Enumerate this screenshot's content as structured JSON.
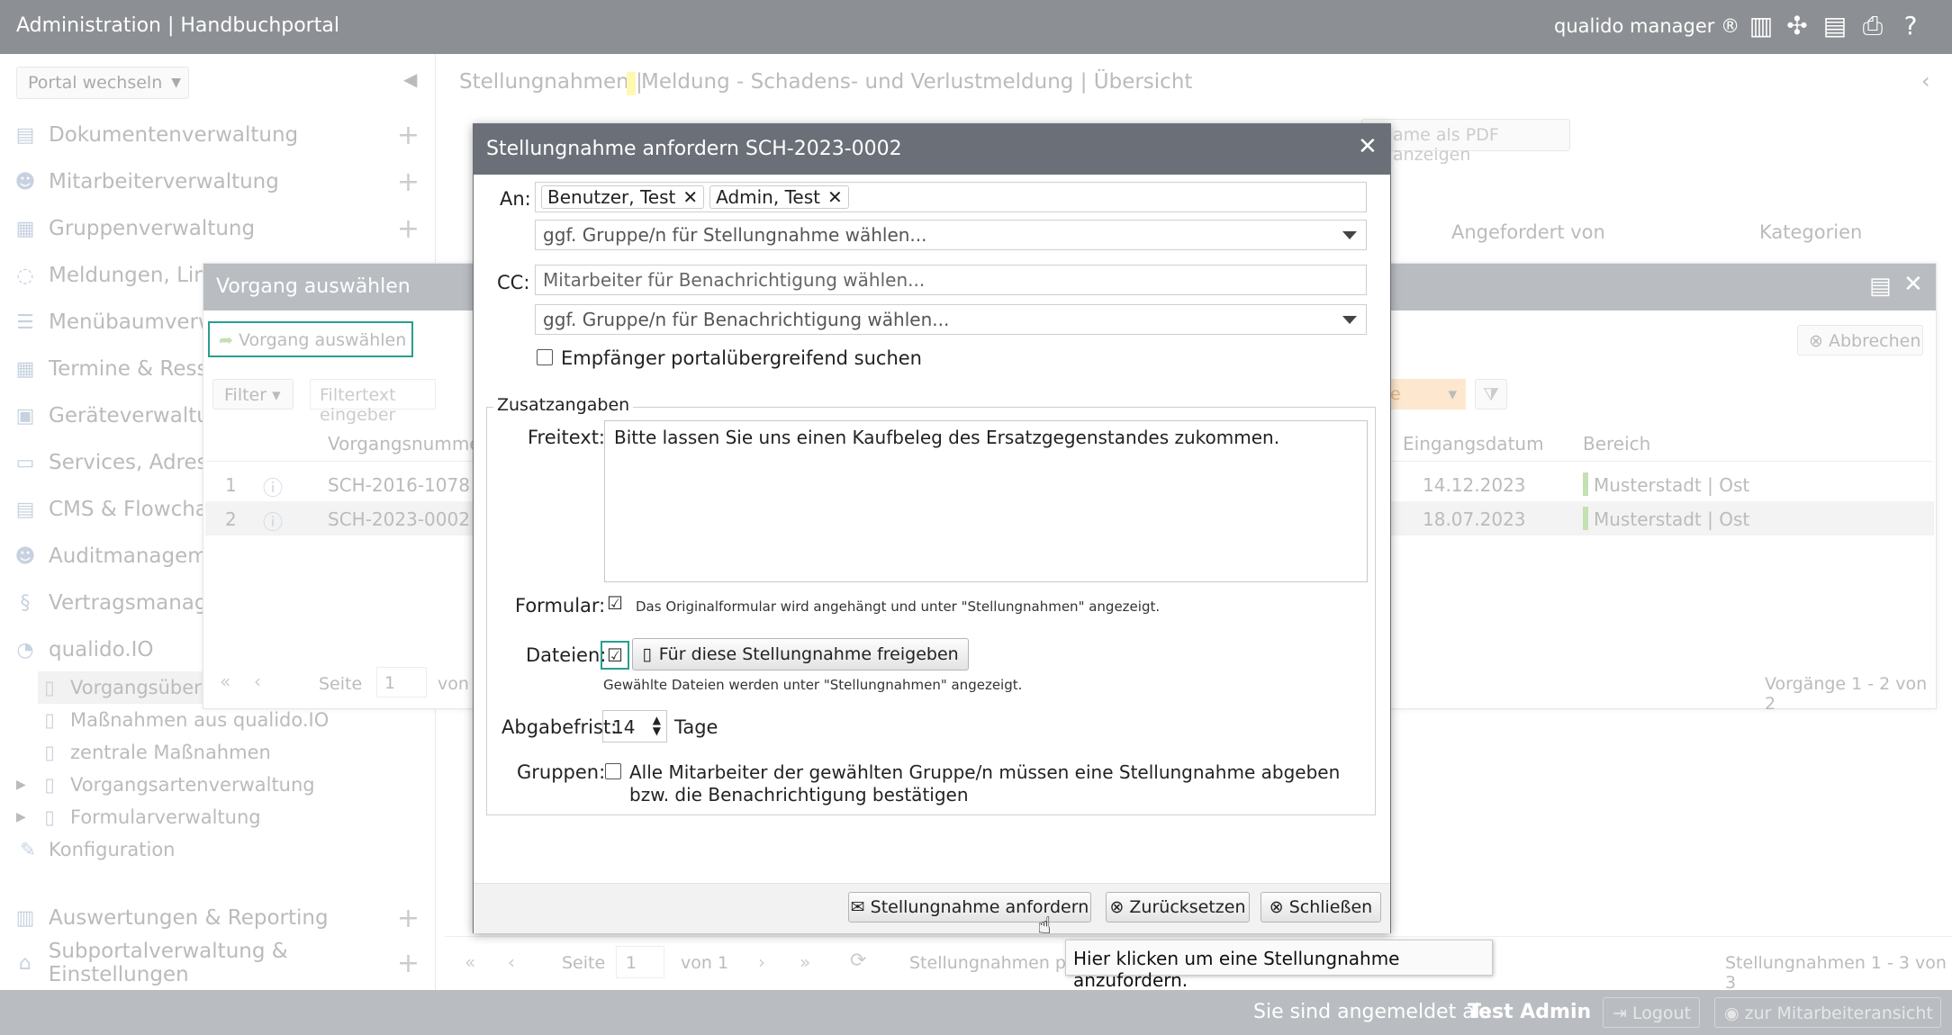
{
  "topbar": {
    "title": "Administration | Handbuchportal",
    "brand": "qualido manager ®"
  },
  "sidebar": {
    "portal_switch": "Portal wechseln",
    "items": [
      {
        "label": "Dokumentenverwaltung",
        "icon": "documents-icon"
      },
      {
        "label": "Mitarbeiterverwaltung",
        "icon": "users-icon"
      },
      {
        "label": "Gruppenverwaltung",
        "icon": "groups-icon"
      },
      {
        "label": "Meldungen, Links",
        "icon": "chat-icon"
      },
      {
        "label": "Menübaumverwal",
        "icon": "list-icon"
      },
      {
        "label": "Termine & Ressou",
        "icon": "calendar-icon"
      },
      {
        "label": "Geräteverwaltung",
        "icon": "device-icon"
      },
      {
        "label": "Services, Adresser",
        "icon": "book-icon"
      },
      {
        "label": "CMS & Flowcharts",
        "icon": "cms-icon"
      },
      {
        "label": "Auditmanagemen",
        "icon": "audit-icon"
      },
      {
        "label": "Vertragsmanagem",
        "icon": "paragraph-icon"
      },
      {
        "label": "qualido.IO",
        "icon": "spinner-icon"
      }
    ],
    "subitems": [
      "Vorgangsübersi",
      "Maßnahmen aus qualido.IO",
      "zentrale Maßnahmen",
      "Vorgangsartenverwaltung",
      "Formularverwaltung",
      "Konfiguration"
    ],
    "bottom": [
      "Auswertungen & Reporting",
      "Subportalverwaltung & Einstellungen"
    ]
  },
  "header": {
    "breadcrumb_1": "Stellungnahmen |",
    "breadcrumb_2": "Meldung - Schadens- und Verlustmeldung | Übersicht",
    "pdf_button": "ame als PDF anzeigen",
    "col_requested_by": "Angefordert von",
    "col_categories": "Kategorien"
  },
  "sub_dialog": {
    "title": "Vorgang auswählen",
    "select_button": "Vorgang auswählen",
    "cancel_button": "Abbrechen",
    "filter_label": "Filter",
    "filter_placeholder": "Filtertext eingeber",
    "status_value": "e",
    "columns": {
      "number": "Vorgangsnummer",
      "date": "Eingangsdatum",
      "area": "Bereich"
    },
    "rows": [
      {
        "idx": "1",
        "number": "SCH-2016-1078",
        "date": "14.12.2023",
        "area": "Musterstadt | Ost"
      },
      {
        "idx": "2",
        "number": "SCH-2023-0002",
        "date": "18.07.2023",
        "area": "Musterstadt | Ost"
      }
    ],
    "pager": {
      "page_label": "Seite",
      "page": "1",
      "of": "von",
      "summary": "Vorgänge 1 - 2 von 2"
    }
  },
  "bottom_pager": {
    "page_label": "Seite",
    "page": "1",
    "of": "von 1",
    "status": "Stellungnahmen pro",
    "summary": "Stellungnahmen 1 - 3 von 3"
  },
  "footer": {
    "logged_in": "Sie sind angemeldet als",
    "user": "Test Admin",
    "logout": "Logout",
    "employee_view": "zur Mitarbeiteransicht"
  },
  "dialog": {
    "title": "Stellungnahme anfordern SCH-2023-0002",
    "to_label": "An:",
    "recipients": [
      "Benutzer, Test",
      "Admin, Test"
    ],
    "group_placeholder": "ggf. Gruppe/n für Stellungnahme wählen...",
    "cc_label": "CC:",
    "cc_placeholder": "Mitarbeiter für Benachrichtigung wählen...",
    "cc_group_placeholder": "ggf. Gruppe/n für Benachrichtigung wählen...",
    "cross_portal_label": "Empfänger portalübergreifend suchen",
    "extra_legend": "Zusatzangaben",
    "freetext_label": "Freitext:",
    "freetext_value": "Bitte lassen Sie uns einen Kaufbeleg des Ersatzgegenstandes zukommen.",
    "form_label": "Formular:",
    "form_note": "Das Originalformular wird angehängt und unter \"Stellungnahmen\" angezeigt.",
    "files_label": "Dateien:",
    "files_button": "Für diese Stellungnahme freigeben",
    "files_note": "Gewählte Dateien werden unter \"Stellungnahmen\" angezeigt.",
    "deadline_label": "Abgabefrist:",
    "deadline_value": "14",
    "deadline_unit": "Tage",
    "groups_label": "Gruppen:",
    "groups_text": "Alle Mitarbeiter der gewählten Gruppe/n müssen eine Stellungnahme abgeben bzw. die Benachrichtigung bestätigen",
    "request_button": "Stellungnahme anfordern",
    "reset_button": "Zurücksetzen",
    "close_button": "Schließen"
  },
  "tooltip": "Hier klicken um eine Stellungnahme anzufordern."
}
